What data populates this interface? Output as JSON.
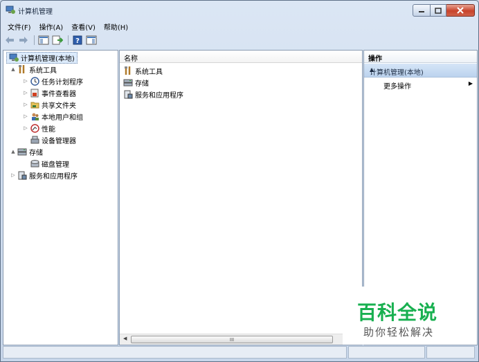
{
  "window": {
    "title": "计算机管理",
    "title_icon": "computer-management-icon"
  },
  "menu": [
    "文件(F)",
    "操作(A)",
    "查看(V)",
    "帮助(H)"
  ],
  "toolbar": [
    "back-arrow-icon",
    "forward-arrow-icon",
    "show-hide-tree-icon",
    "export-list-icon",
    "help-icon",
    "show-hide-action-pane-icon"
  ],
  "tree": {
    "root": "计算机管理(本地)",
    "items": [
      {
        "label": "系统工具",
        "icon": "tools-icon",
        "expander": "▲"
      },
      {
        "label": "任务计划程序",
        "icon": "clock-icon",
        "expander": "▷"
      },
      {
        "label": "事件查看器",
        "icon": "event-viewer-icon",
        "expander": "▷"
      },
      {
        "label": "共享文件夹",
        "icon": "shared-folder-icon",
        "expander": "▷"
      },
      {
        "label": "本地用户和组",
        "icon": "users-icon",
        "expander": "▷"
      },
      {
        "label": "性能",
        "icon": "performance-icon",
        "expander": "▷"
      },
      {
        "label": "设备管理器",
        "icon": "device-manager-icon",
        "expander": ""
      },
      {
        "label": "存储",
        "icon": "storage-icon",
        "expander": "▲"
      },
      {
        "label": "磁盘管理",
        "icon": "disk-icon",
        "expander": ""
      },
      {
        "label": "服务和应用程序",
        "icon": "services-icon",
        "expander": "▷"
      }
    ]
  },
  "list": {
    "column": "名称",
    "rows": [
      "系统工具",
      "存储",
      "服务和应用程序"
    ],
    "scroll_thumb_glyph": "III"
  },
  "actions": {
    "header": "操作",
    "section": "计算机管理(本地)",
    "item": "更多操作"
  },
  "watermark": {
    "title": "百科全说",
    "subtitle": "助你轻松解决"
  },
  "colors": {
    "accent": "#18b050",
    "selection": "#dcebfc",
    "close": "#c8432b"
  }
}
